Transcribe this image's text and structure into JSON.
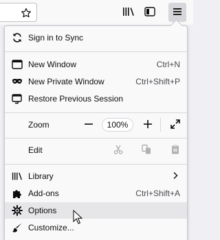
{
  "menu": {
    "sign_in": "Sign in to Sync",
    "new_window": {
      "label": "New Window",
      "shortcut": "Ctrl+N"
    },
    "new_private": {
      "label": "New Private Window",
      "shortcut": "Ctrl+Shift+P"
    },
    "restore": "Restore Previous Session",
    "zoom": {
      "label": "Zoom",
      "value": "100%"
    },
    "edit": "Edit",
    "library": "Library",
    "addons": {
      "label": "Add-ons",
      "shortcut": "Ctrl+Shift+A"
    },
    "options": "Options",
    "customize": "Customize..."
  },
  "icons": {
    "toolbar": [
      "star-icon",
      "library-icon",
      "sidebar-icon",
      "hamburger-menu-icon"
    ],
    "menu": [
      "sync-icon",
      "new-window-icon",
      "private-mask-icon",
      "restore-session-icon",
      "zoom-out-icon",
      "zoom-in-icon",
      "fullscreen-icon",
      "cut-icon",
      "copy-icon",
      "paste-icon",
      "library-icon",
      "chevron-right-icon",
      "addons-puzzle-icon",
      "options-gear-icon",
      "customize-paintbrush-icon"
    ]
  },
  "colors": {
    "panel_bg": "#f9f9fa",
    "hover_bg": "#e6e6e9",
    "separator": "#d7d7db",
    "icon": "#0c0c0d",
    "disabled_icon": "#b1b1b3"
  }
}
